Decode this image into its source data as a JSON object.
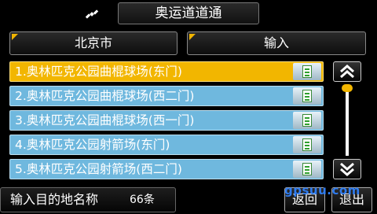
{
  "header": {
    "title": "奥运道道通",
    "satellite_icon": "satellite-icon"
  },
  "top_buttons": {
    "city": "北京市",
    "input": "输入"
  },
  "list": {
    "items": [
      {
        "label": "1.奥林匹克公园曲棍球场(东门)",
        "selected": true
      },
      {
        "label": "2.奥林匹克公园曲棍球场(西二门)",
        "selected": false
      },
      {
        "label": "3.奥林匹克公园曲棍球场(西一门)",
        "selected": false
      },
      {
        "label": "4.奥林匹克公园射箭场(东门)",
        "selected": false
      },
      {
        "label": "5.奥林匹克公园射箭场(西二门)",
        "selected": false
      }
    ],
    "item_icon": "document-icon"
  },
  "scroll": {
    "up_icon": "double-chevron-up-icon",
    "down_icon": "double-chevron-down-icon",
    "position": 0
  },
  "footer": {
    "prompt": "输入目的地名称",
    "count": "66条",
    "back": "返回",
    "exit": "退出"
  },
  "watermark": "gpsuu.com",
  "colors": {
    "selected": "#f2b600",
    "row": "#6fb8de",
    "accent": "#f0b400"
  }
}
